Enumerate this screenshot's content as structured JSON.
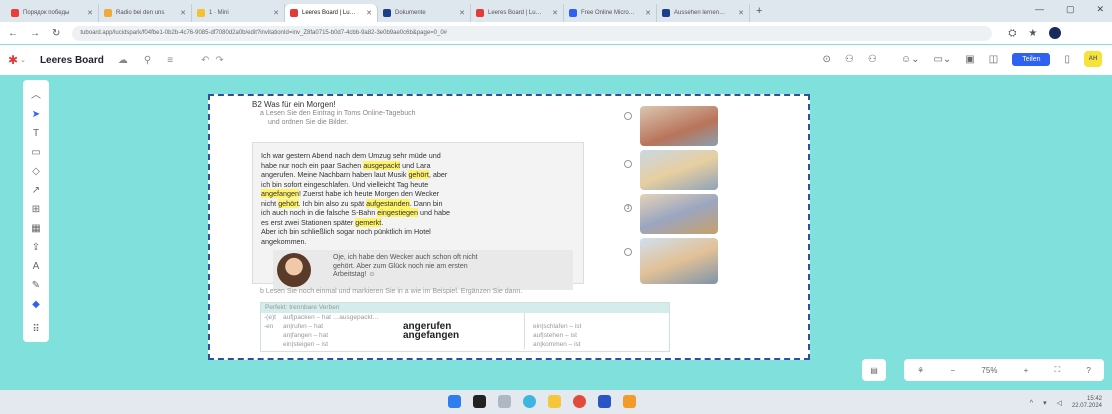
{
  "browser": {
    "tabs": [
      {
        "label": "Порядок победы",
        "color": "#ee3b3b"
      },
      {
        "label": "Radio bei den uns",
        "color": "#f2a93b"
      },
      {
        "label": "1 · Mini",
        "color": "#f2c233"
      },
      {
        "label": "Leeres Board | Lu…",
        "color": "#e03a3a",
        "active": true
      },
      {
        "label": "Dokumente",
        "color": "#1d3f8a"
      },
      {
        "label": "Leeres Board | Lu…",
        "color": "#e03a3a"
      },
      {
        "label": "Free Online Micro…",
        "color": "#2f62f0"
      },
      {
        "label": "Aussehen lernen…",
        "color": "#1d3f8a"
      }
    ],
    "url": "tuboard.app/lucidspark/f04fbe1-0b2b-4c76-9085-df7080d2a0b/edit?invitationId=inv_Z8fa0715-b0d7-4cbb-9a82-3e0b9ae0c6b&page=0_0#"
  },
  "toolbar": {
    "logo": "✱",
    "board_title": "Leeres Board",
    "share_label": "Teilen",
    "avatar_initials": "AH"
  },
  "exercise": {
    "heading": "B2  Was für ein Morgen!",
    "task_a": "a  Lesen Sie den Eintrag in Toms Online-Tagebuch",
    "task_a2": "und ordnen Sie die Bilder.",
    "text_lines": [
      "Ich war gestern Abend nach dem Umzug sehr müde und",
      "habe nur noch ein paar Sachen ausgepackt und Lara",
      "angerufen. Meine Nachbarn haben laut Musik gehört, aber",
      "ich bin sofort eingeschlafen. Und vielleicht Tag heute",
      "angefangen! Zuerst habe ich heute Morgen den Wecker",
      "nicht gehört. Ich bin also zu spät aufgestanden. Dann bin",
      "ich auch noch in die falsche S-Bahn eingestiegen und habe",
      "es erst zwei Stationen später gemerkt.",
      "Aber ich bin schließlich sogar noch pünktlich im Hotel",
      "angekommen."
    ],
    "speech": [
      "Oje, ich habe den Wecker auch schon oft nicht",
      "gehört. Aber zum Glück noch nie am ersten",
      "Arbeitstag! ☺"
    ],
    "task_b": "b  Lesen Sie noch einmal und markieren Sie in a wie im Beispiel. Ergänzen Sie dann.",
    "table_header": "Perfekt: trennbare Verben",
    "rows": [
      {
        "c1": "-(e)t",
        "c2": "auf|packen – hat …ausgepackt…",
        "c3": "",
        "c4": ""
      },
      {
        "c1": "-en",
        "c2": "an|rufen    – hat",
        "c3": "angerufen",
        "c4": "ein|schlafen  – ist"
      },
      {
        "c1": "",
        "c2": "an|fangen  – hat",
        "c3": "angefangen",
        "c4": "auf|stehen   – ist"
      },
      {
        "c1": "",
        "c2": "ein|steigen  – ist",
        "c3": "",
        "c4": "an|kommen   – ist"
      }
    ],
    "circles": [
      "",
      "",
      "3",
      ""
    ]
  },
  "zoom": {
    "level": "75%",
    "minus": "−",
    "plus": "+"
  },
  "taskbar": {
    "time": "15:42",
    "date": "22.07.2024"
  }
}
